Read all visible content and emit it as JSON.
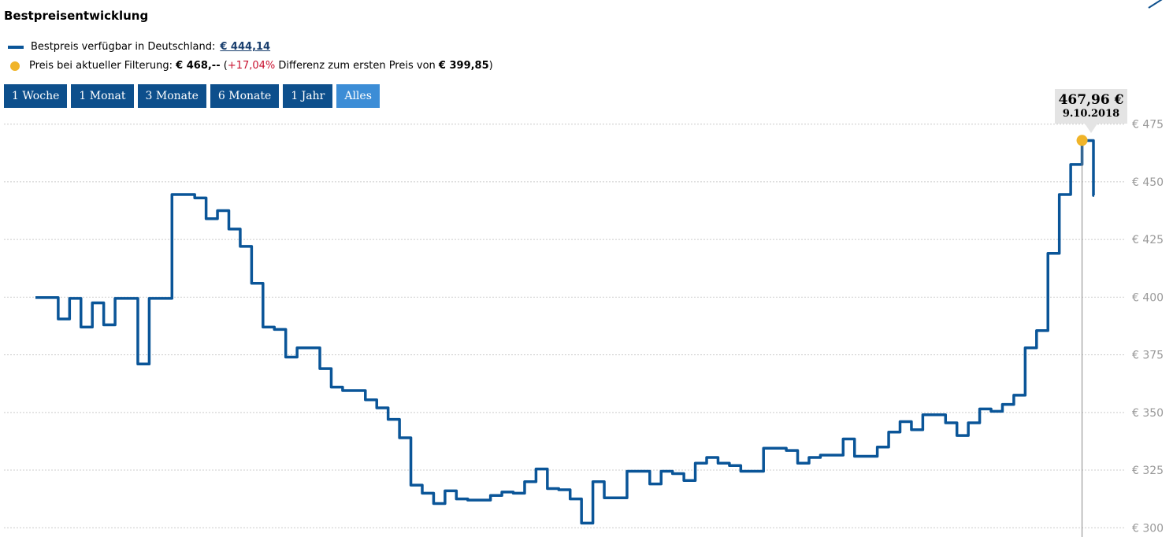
{
  "title": "Bestpreisentwicklung",
  "legend": {
    "line_label": "Bestpreis verfügbar in Deutschland:",
    "line_value": "€ 444,14",
    "dot_label": "Preis bei aktueller Filterung:",
    "dot_value": "€ 468,--",
    "diff_open": "(",
    "diff_value": "+17,04%",
    "diff_text": "Differenz zum ersten Preis von",
    "first_price": "€ 399,85",
    "diff_close": ")"
  },
  "range_buttons": [
    {
      "label": "1 Woche",
      "active": false
    },
    {
      "label": "1 Monat",
      "active": false
    },
    {
      "label": "3 Monate",
      "active": false
    },
    {
      "label": "6 Monate",
      "active": false
    },
    {
      "label": "1 Jahr",
      "active": false
    },
    {
      "label": "Alles",
      "active": true
    }
  ],
  "tooltip": {
    "value": "467,96 €",
    "date": "9.10.2018"
  },
  "colors": {
    "line": "#0a5598",
    "dot": "#f0b429",
    "button": "#0d4f8c",
    "button_active": "#3c8dd6",
    "grid": "#cccccc",
    "tick_text": "#999999",
    "positive": "#c8102e"
  },
  "icons": {
    "corner": "expand-arrow-icon"
  },
  "chart_data": {
    "type": "line",
    "ylim": [
      296,
      480
    ],
    "yticks": [
      475,
      450,
      425,
      400,
      375,
      350,
      325,
      300
    ],
    "ytick_labels": [
      "€ 475",
      "€ 450",
      "€ 425",
      "€ 400",
      "€ 375",
      "€ 350",
      "€ 325",
      "€ 300"
    ],
    "grid": true,
    "highlight": {
      "index": 92,
      "y": 467.96,
      "label": "467,96 €",
      "date": "9.10.2018"
    },
    "series": [
      {
        "x": [
          0,
          1,
          2,
          3,
          4,
          5,
          6,
          7,
          8,
          9,
          10,
          11,
          12,
          13,
          14,
          15,
          16,
          17,
          18,
          19,
          20,
          21,
          22,
          23,
          24,
          25,
          26,
          27,
          28,
          29,
          30,
          31,
          32,
          33,
          34,
          35,
          36,
          37,
          38,
          39,
          40,
          41,
          42,
          43,
          44,
          45,
          46,
          47,
          48,
          49,
          50,
          51,
          52,
          53,
          54,
          55,
          56,
          57,
          58,
          59,
          60,
          61,
          62,
          63,
          64,
          65,
          66,
          67,
          68,
          69,
          70,
          71,
          72,
          73,
          74,
          75,
          76,
          77,
          78,
          79,
          80,
          81,
          82,
          83,
          84,
          85,
          86,
          87,
          88,
          89,
          90,
          91,
          92,
          93
        ],
        "y": [
          399.8,
          399.8,
          390.5,
          399.5,
          387.0,
          397.5,
          388.0,
          399.5,
          399.5,
          371.0,
          399.5,
          399.5,
          444.5,
          444.5,
          443.0,
          434.0,
          437.5,
          429.5,
          422.0,
          406.0,
          387.0,
          386.0,
          374.0,
          378.0,
          378.0,
          369.0,
          361.0,
          359.5,
          359.5,
          355.5,
          352.0,
          347.0,
          339.0,
          318.5,
          315.0,
          310.5,
          316.0,
          312.5,
          312.0,
          312.0,
          314.0,
          315.5,
          315.0,
          320.0,
          325.5,
          317.0,
          316.5,
          312.5,
          302.0,
          320.0,
          313.0,
          313.0,
          324.5,
          324.5,
          319.0,
          324.5,
          323.5,
          320.5,
          328.0,
          330.5,
          328.0,
          327.0,
          324.5,
          324.5,
          334.5,
          334.5,
          333.5,
          328.0,
          330.5,
          331.5,
          331.5,
          338.5,
          331.0,
          331.0,
          335.0,
          341.5,
          346.0,
          342.5,
          349.0,
          349.0,
          345.5,
          340.0,
          345.5,
          351.5,
          350.5,
          353.5,
          357.5,
          378.0,
          385.5,
          419.0,
          444.5,
          457.5,
          467.9,
          444.1
        ]
      }
    ]
  }
}
